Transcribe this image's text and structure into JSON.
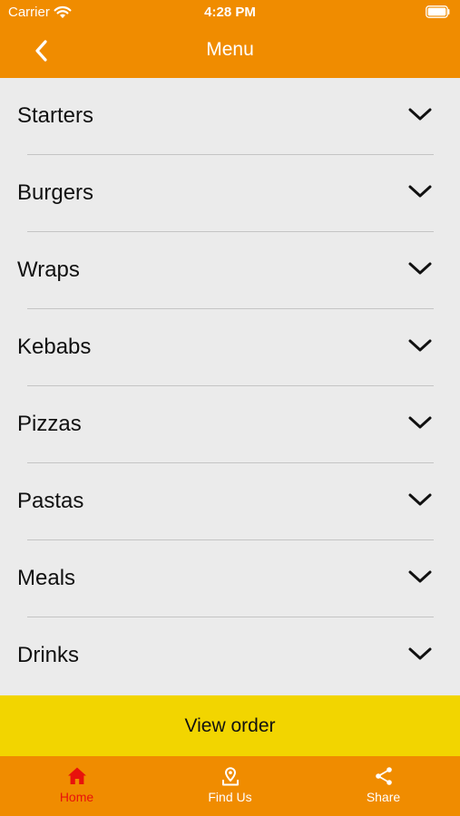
{
  "status_bar": {
    "carrier": "Carrier",
    "time": "4:28 PM"
  },
  "header": {
    "title": "Menu",
    "back_icon": "chevron-left-icon"
  },
  "menu": {
    "items": [
      {
        "label": "Starters"
      },
      {
        "label": "Burgers"
      },
      {
        "label": "Wraps"
      },
      {
        "label": "Kebabs"
      },
      {
        "label": "Pizzas"
      },
      {
        "label": "Pastas"
      },
      {
        "label": "Meals"
      },
      {
        "label": "Drinks"
      }
    ],
    "expand_icon": "chevron-down-icon"
  },
  "view_order": {
    "label": "View order"
  },
  "tab_bar": {
    "tabs": [
      {
        "label": "Home",
        "icon": "home-icon",
        "active": true
      },
      {
        "label": "Find Us",
        "icon": "location-pin-icon",
        "active": false
      },
      {
        "label": "Share",
        "icon": "share-icon",
        "active": false
      }
    ]
  },
  "colors": {
    "header_background": "#f08c00",
    "tab_bar_background": "#f08c00",
    "view_order_background": "#f2d500",
    "list_background": "#ebebeb",
    "active_tab": "#e8120c",
    "inactive_tab": "#ffffff"
  }
}
